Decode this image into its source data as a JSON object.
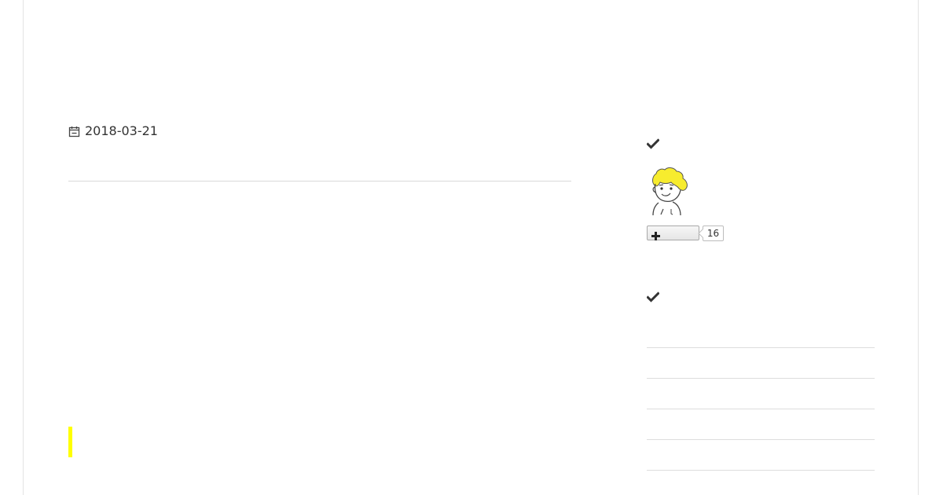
{
  "post": {
    "date": "2018-03-21"
  },
  "sidebar": {
    "follow_widget": {
      "count": "16"
    }
  },
  "icons": {
    "date": "calendar-icon",
    "widget_title": "check-icon",
    "follow": "plus-icon"
  },
  "colors": {
    "accent": "#ffff00",
    "text": "#333333",
    "divider": "#d9d9d9"
  }
}
